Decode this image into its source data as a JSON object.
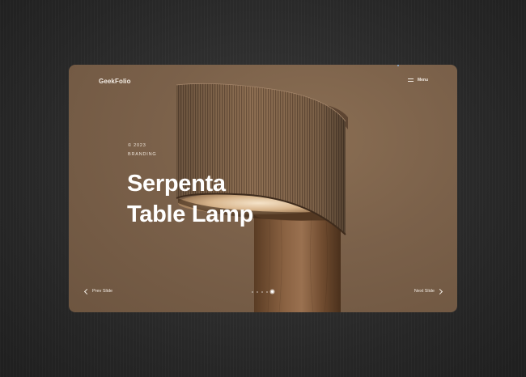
{
  "header": {
    "logo": "GeekFolio",
    "menu_label": "Menu"
  },
  "slide": {
    "year": "© 2023",
    "category": "BRANDING",
    "title_line1": "Serpenta",
    "title_line2": "Table Lamp"
  },
  "navigation": {
    "prev_label": "Prev Slide",
    "next_label": "Next Slide",
    "slide_count": 5,
    "active_slide": 5
  },
  "icons": {
    "menu": "hamburger-icon",
    "prev": "chevron-left-icon",
    "next": "chevron-right-icon"
  },
  "colors": {
    "card_background": "#7b614a",
    "page_background": "#2a2a2a",
    "text": "#ffffff"
  }
}
